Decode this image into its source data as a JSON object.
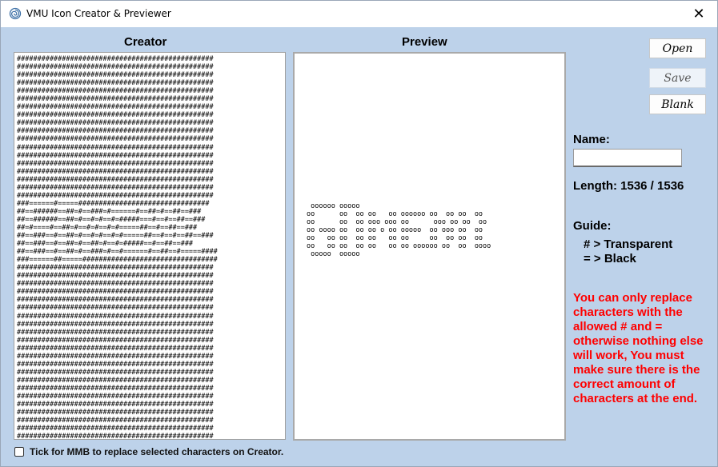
{
  "window": {
    "title": "VMU Icon Creator & Previewer",
    "close_glyph": "✕"
  },
  "creator": {
    "label": "Creator",
    "lines": [
      "################################################",
      "################################################",
      "################################################",
      "################################################",
      "################################################",
      "################################################",
      "################################################",
      "################################################",
      "################################################",
      "################################################",
      "################################################",
      "################################################",
      "################################################",
      "################################################",
      "################################################",
      "################################################",
      "################################################",
      "################################################",
      "###======#=====################################",
      "##==######==##=#==###=#======#==##=#==##==###",
      "##==######==##=#==#=#==#=#####===#==#==##==###",
      "##=#====#==##=#==#=#==#=#=====##==#==##==###",
      "##==###==#==##=#==#=#==#=#=====##==#==#==##==###",
      "##==###==#==##=#==##=#==#=#####==#==##==###",
      "##==###==#==##=#==###=#==#======#==##==#=====####",
      "###======##=====#################################",
      "################################################",
      "################################################",
      "################################################",
      "################################################",
      "################################################",
      "################################################",
      "################################################",
      "################################################",
      "################################################",
      "################################################",
      "################################################",
      "################################################",
      "################################################",
      "################################################",
      "################################################",
      "################################################",
      "################################################",
      "################################################",
      "################################################",
      "################################################",
      "################################################",
      "################################################"
    ]
  },
  "preview": {
    "label": "Preview",
    "lines": [
      " oooooo ooooo",
      "oo      oo  oo oo   oo oooooo oo  oo oo  oo",
      "oo      oo  oo ooo ooo oo      ooo oo oo  oo",
      "oo oooo oo  oo oo o oo ooooo  oo ooo oo  oo",
      "oo   oo oo  oo oo   oo oo     oo  oo oo  oo",
      "oo   oo oo  oo oo   oo oo oooooo oo  oo  oooo",
      " ooooo  ooooo"
    ]
  },
  "buttons": {
    "open": "Open",
    "save": "Save",
    "blank": "Blank"
  },
  "name_field": {
    "label": "Name:",
    "value": ""
  },
  "length": {
    "text": "Length: 1536 / 1536"
  },
  "guide": {
    "label": "Guide:",
    "transparent": "# > Transparent",
    "black": "= > Black"
  },
  "warning": {
    "text": "You can only replace characters with the allowed # and = otherwise nothing else will work, You must make sure there is the correct amount of characters at the end."
  },
  "mmb_option": {
    "label": "Tick for MMB to replace selected characters on Creator.",
    "checked": false
  },
  "colors": {
    "background": "#bdd2ea",
    "warning": "#ff0000"
  }
}
